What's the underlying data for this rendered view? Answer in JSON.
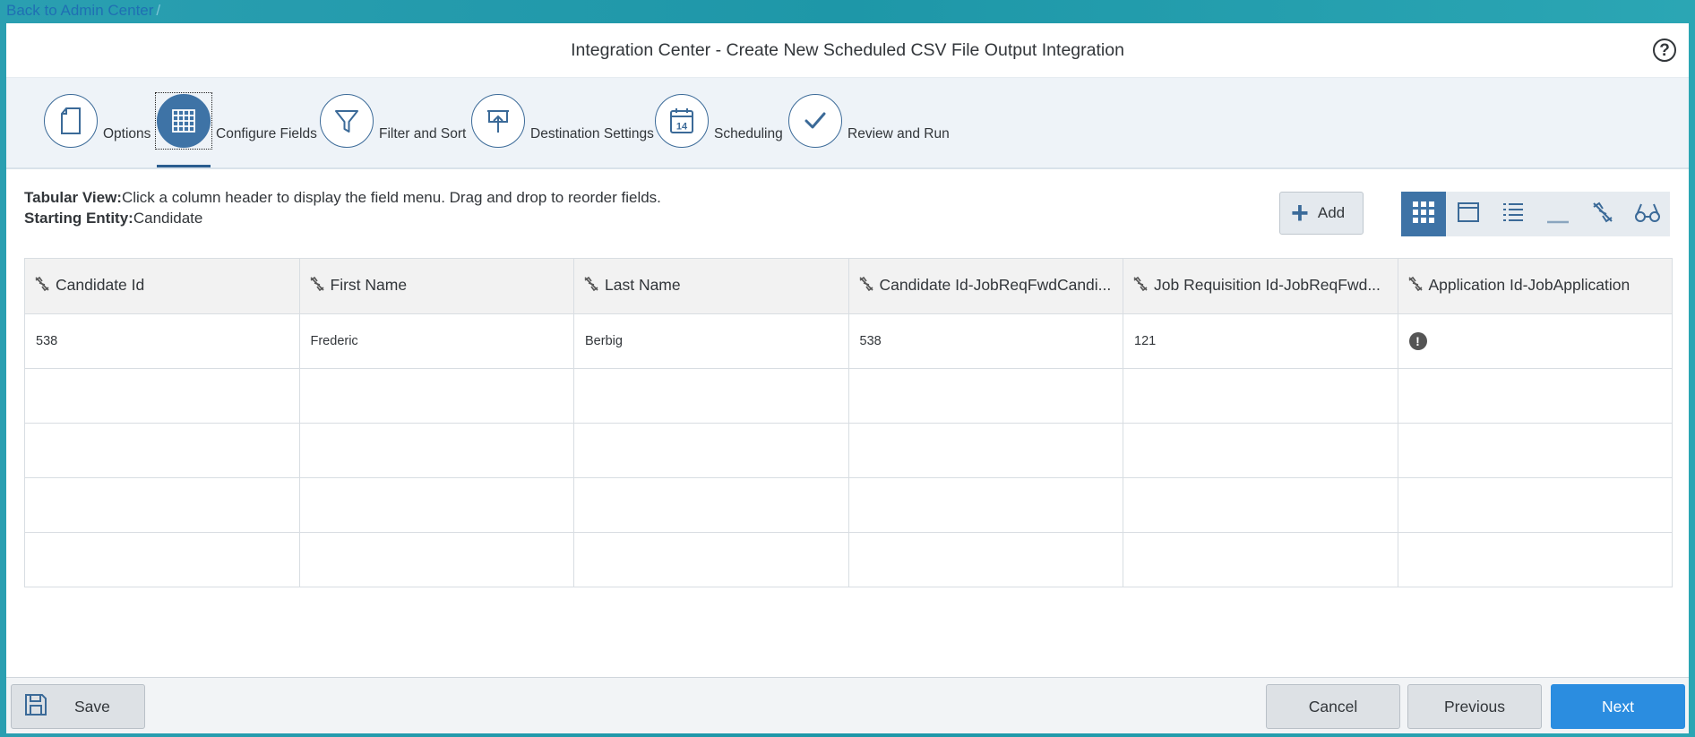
{
  "breadcrumb": {
    "back_label": "Back to Admin Center",
    "separator": "/"
  },
  "header": {
    "title": "Integration Center - Create New Scheduled CSV File Output Integration",
    "help_label": "?"
  },
  "wizard": {
    "steps": [
      {
        "label": "Options",
        "icon": "page-icon"
      },
      {
        "label": "Configure Fields",
        "icon": "grid-icon",
        "active": true
      },
      {
        "label": "Filter and Sort",
        "icon": "filter-icon"
      },
      {
        "label": "Destination Settings",
        "icon": "upload-icon"
      },
      {
        "label": "Scheduling",
        "icon": "calendar-icon",
        "calendar_day": "14"
      },
      {
        "label": "Review and Run",
        "icon": "checkmark-icon"
      }
    ]
  },
  "info": {
    "view_label": "Tabular View:",
    "view_text": "Click a column header to display the field menu. Drag and drop to reorder fields.",
    "entity_label": "Starting Entity:",
    "entity_value": "Candidate"
  },
  "toolbar": {
    "add_label": "Add",
    "view_icons": [
      "grid-view-icon",
      "card-view-icon",
      "list-view-icon",
      "minimize-icon",
      "link-icon",
      "preview-icon"
    ]
  },
  "table": {
    "columns": [
      "Candidate Id",
      "First Name",
      "Last Name",
      "Candidate Id-JobReqFwdCandi...",
      "Job Requisition Id-JobReqFwd...",
      "Application Id-JobApplication"
    ],
    "rows": [
      [
        "538",
        "Frederic",
        "Berbig",
        "538",
        "121",
        "!"
      ]
    ]
  },
  "footer": {
    "save_label": "Save",
    "cancel_label": "Cancel",
    "previous_label": "Previous",
    "next_label": "Next"
  },
  "colors": {
    "accent": "#3e73a6",
    "primary_button": "#2b8de0",
    "frame": "#1e97a8"
  }
}
